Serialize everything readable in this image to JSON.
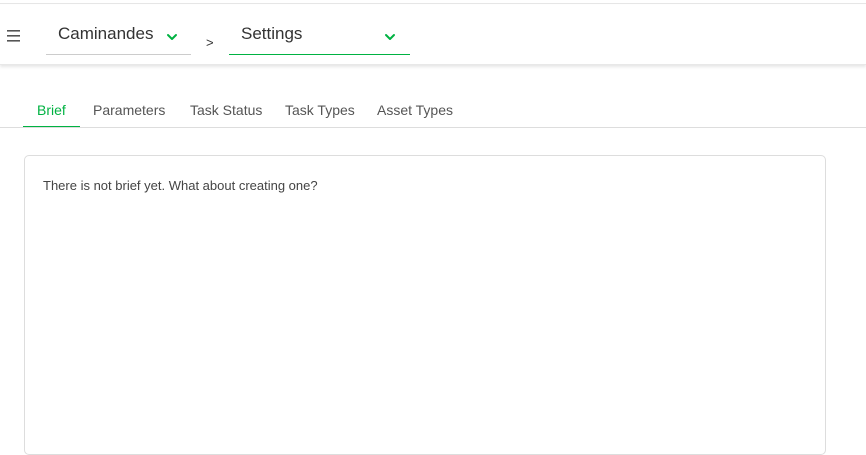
{
  "header": {
    "menu_icon": "hamburger-menu-icon",
    "production": {
      "label": "Caminandes",
      "icon": "chevron-down-icon"
    },
    "separator": ">",
    "section": {
      "label": "Settings",
      "icon": "chevron-down-icon"
    }
  },
  "tabs": [
    {
      "label": "Brief",
      "active": true
    },
    {
      "label": "Parameters",
      "active": false
    },
    {
      "label": "Task Status",
      "active": false
    },
    {
      "label": "Task Types",
      "active": false
    },
    {
      "label": "Asset Types",
      "active": false
    }
  ],
  "brief": {
    "empty_text": "There is not brief yet. What about creating one?"
  },
  "colors": {
    "accent": "#00b242",
    "text": "#333333",
    "border": "#dddddd"
  }
}
